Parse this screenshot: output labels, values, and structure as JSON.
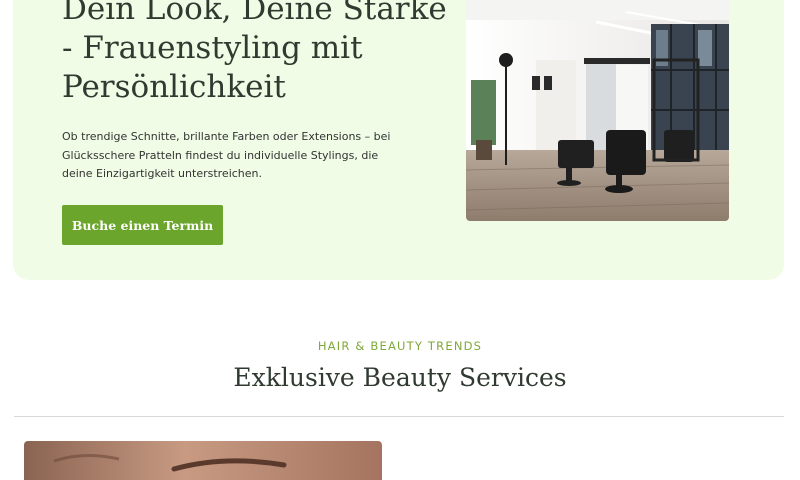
{
  "hero": {
    "title": "Dein Look, Deine Stärke - Frauenstyling mit Persönlichkeit",
    "description": "Ob trendige Schnitte, brillante Farben oder Extensions – bei Glücksschere Pratteln findest du individuelle Stylings, die deine Einzigartigkeit unterstreichen.",
    "cta_label": "Buche einen Termin"
  },
  "services": {
    "eyebrow": "HAIR & BEAUTY TRENDS",
    "title": "Exklusive Beauty Services"
  },
  "colors": {
    "hero_background": "#f0fce6",
    "accent_green": "#6ba52b",
    "eyebrow_green": "#7fa83a",
    "heading_text": "#2f3a30"
  }
}
